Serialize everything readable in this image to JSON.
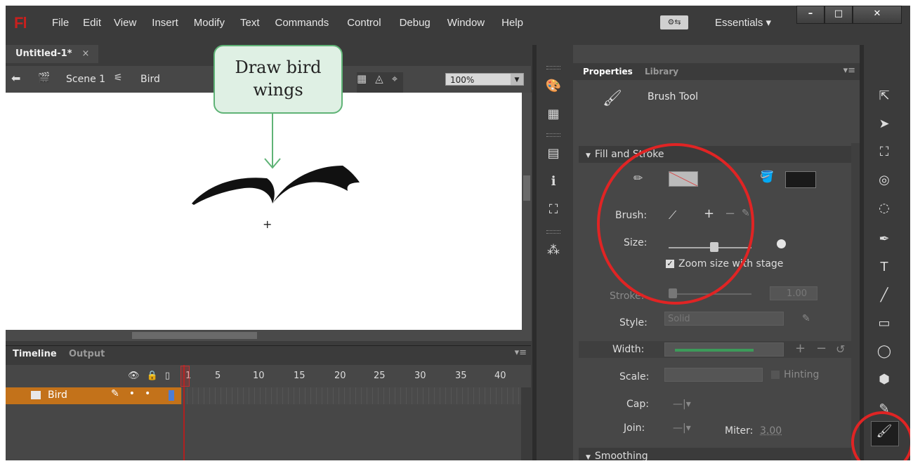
{
  "app": {
    "logo": "Fl"
  },
  "menu": [
    "File",
    "Edit",
    "View",
    "Insert",
    "Modify",
    "Text",
    "Commands",
    "Control",
    "Debug",
    "Window",
    "Help"
  ],
  "workspace": {
    "name": "Essentials",
    "switcher_label": "⚙⇆"
  },
  "window_controls": {
    "minimize": "–",
    "maximize": "□",
    "close": "✕"
  },
  "document": {
    "tab": "Untitled-1*",
    "close": "×"
  },
  "edit_bar": {
    "scene": "Scene 1",
    "symbol": "Bird",
    "zoom": "100%"
  },
  "callout": {
    "text_line1": "Draw bird",
    "text_line2": "wings"
  },
  "timeline": {
    "tab_timeline": "Timeline",
    "tab_output": "Output",
    "frames": [
      "1",
      "5",
      "10",
      "15",
      "20",
      "25",
      "30",
      "35",
      "40"
    ],
    "layer": "Bird"
  },
  "properties": {
    "tab_properties": "Properties",
    "tab_library": "Library",
    "tool_name": "Brush Tool",
    "section_fill_stroke": "Fill and Stroke",
    "brush_label": "Brush:",
    "size_label": "Size:",
    "size_value": 0.55,
    "zoom_with_stage": "Zoom size with stage",
    "stroke_label": "Stroke:",
    "stroke_value": "1.00",
    "style_label": "Style:",
    "style_value": "Solid",
    "width_label": "Width:",
    "scale_label": "Scale:",
    "hinting_label": "Hinting",
    "cap_label": "Cap:",
    "join_label": "Join:",
    "miter_label": "Miter:",
    "miter_value": "3.00",
    "section_smoothing": "Smoothing"
  },
  "colors": {
    "accent_red": "#e02424",
    "callout_green": "#5fb376",
    "layer_orange": "#c3721a"
  }
}
